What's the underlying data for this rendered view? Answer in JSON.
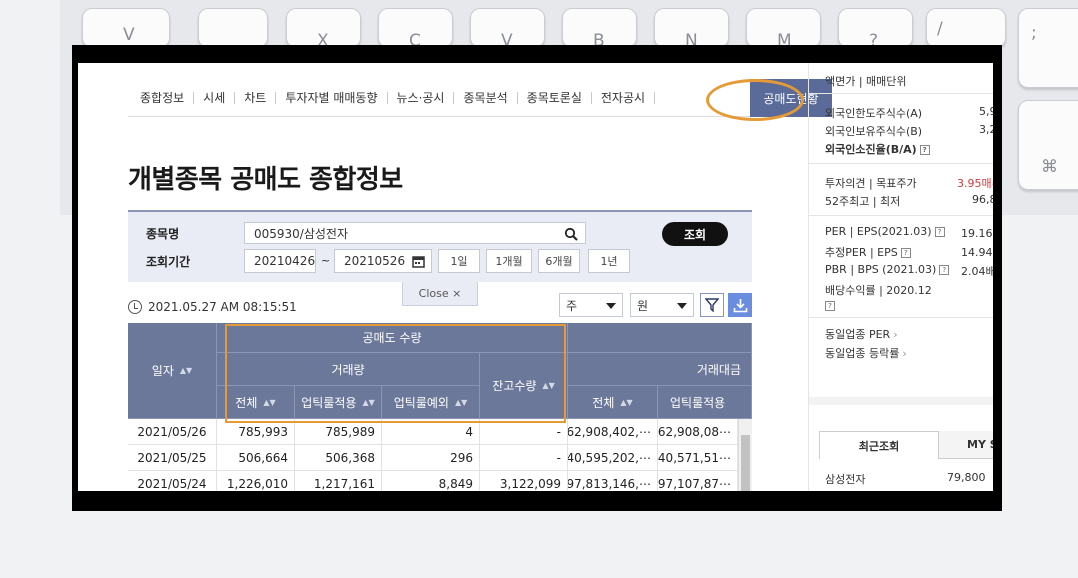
{
  "keyboard": {
    "keys": [
      "V",
      "X",
      "C",
      "V",
      "B",
      "N",
      "M",
      "?",
      "/",
      ":",
      ";",
      "⌘"
    ]
  },
  "nav": {
    "items": [
      "종합정보",
      "시세",
      "차트",
      "투자자별 매매동향",
      "뉴스·공시",
      "종목분석",
      "종목토론실",
      "전자공시"
    ],
    "active": "공매도현황"
  },
  "page_title": "개별종목 공매도 종합정보",
  "search": {
    "stock_label": "종목명",
    "stock_value": "005930/삼성전자",
    "period_label": "조회기간",
    "date_from": "20210426",
    "tilde": "~",
    "date_to": "20210526",
    "periods": [
      "1일",
      "1개월",
      "6개월",
      "1년"
    ],
    "submit_label": "조회",
    "close_label": "Close ×"
  },
  "timestamp": "2021.05.27 AM 08:15:51",
  "filters": {
    "unit1": "주",
    "unit2": "원"
  },
  "table": {
    "h_date": "일자",
    "h_short_qty": "공매도 수량",
    "h_trade_qty": "거래량",
    "h_balance": "잔고수량",
    "h_trade_amt": "거래대금",
    "h_total": "전체",
    "h_uptick": "업틱룰적용",
    "h_uptick_ex": "업틱룰예외",
    "h_total2": "전체",
    "h_uptick2": "업틱룰적용",
    "rows": [
      [
        "2021/05/26",
        "785,993",
        "785,989",
        "4",
        "-",
        "62,908,402,⋯",
        "62,908,08⋯"
      ],
      [
        "2021/05/25",
        "506,664",
        "506,368",
        "296",
        "-",
        "40,595,202,⋯",
        "40,571,51⋯"
      ],
      [
        "2021/05/24",
        "1,226,010",
        "1,217,161",
        "8,849",
        "3,122,099",
        "97,813,146,⋯",
        "97,107,87⋯"
      ]
    ]
  },
  "side": {
    "l1": "액면가 | 매매단위",
    "l2": "외국인한도주식수(A)",
    "v2": "5,9",
    "l3": "외국인보유주식수(B)",
    "v3": "3,2",
    "l4": "외국인소진율(B/A)",
    "l5": "투자의견 | 목표주가",
    "v5": "3.95매수",
    "l6": "52주최고 | 최저",
    "v6": "96,8",
    "l7": "PER | EPS(2021.03)",
    "v7": "19.16배",
    "l8": "추정PER | EPS",
    "v8": "14.94배",
    "l9": "PBR | BPS (2021.03)",
    "v9": "2.04배",
    "l10": "배당수익률 | 2020.12",
    "l11": "동일업종 PER",
    "l12": "동일업종 등락률",
    "tab1": "최근조회",
    "tab2": "MY S",
    "recent_name": "삼성전자",
    "recent_price": "79,800"
  },
  "colors": {
    "accent": "#e69a35",
    "header": "#6b7899",
    "active_tab": "#5a6b9a",
    "red": "#d13a3a"
  }
}
